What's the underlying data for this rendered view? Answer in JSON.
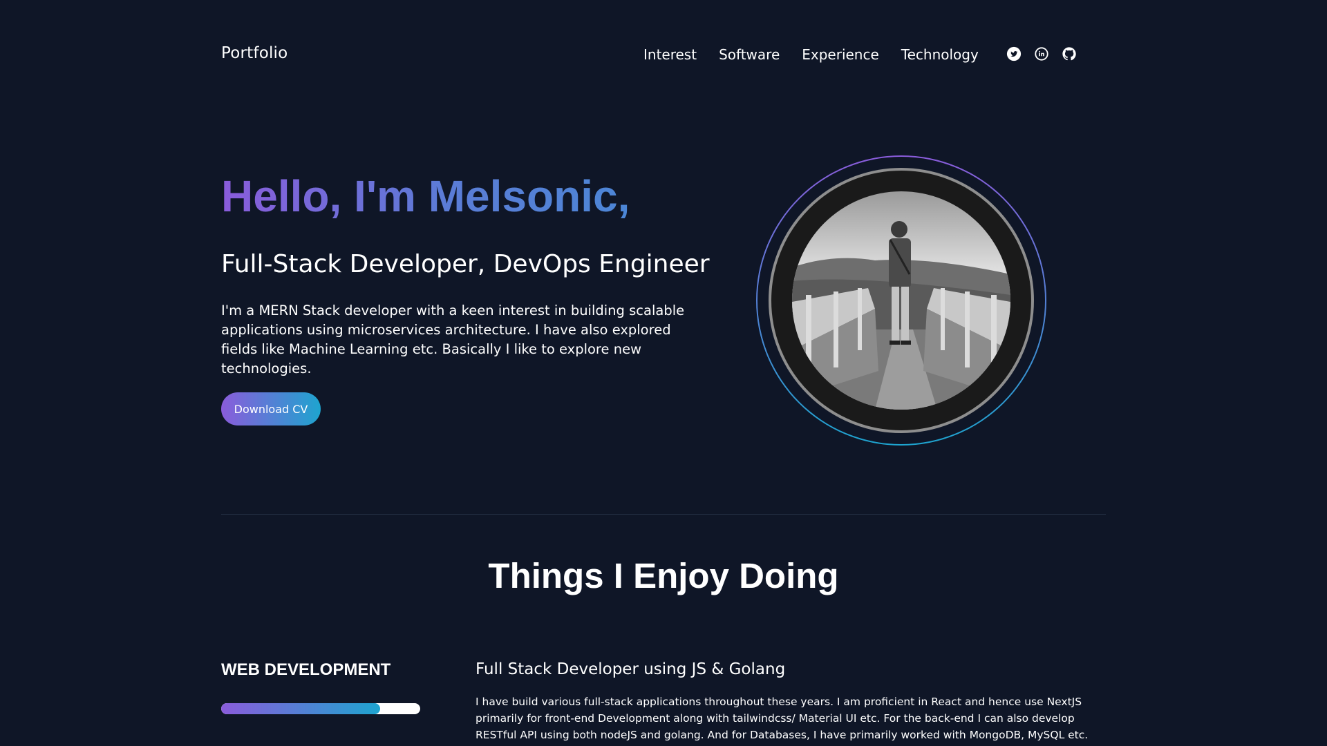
{
  "header": {
    "brand": "Portfolio",
    "nav": [
      "Interest",
      "Software",
      "Experience",
      "Technology"
    ],
    "social_icons": [
      "twitter-icon",
      "linkedin-icon",
      "github-icon"
    ]
  },
  "hero": {
    "greeting": "Hello, I'm Melsonic,",
    "role": "Full-Stack Developer, DevOps Engineer",
    "description": "I'm a MERN Stack developer with a keen interest in building scalable applications using microservices architecture. I have also explored fields like Machine Learning etc. Basically I like to explore new technologies.",
    "cv_button": "Download CV"
  },
  "section": {
    "title": "Things I Enjoy Doing",
    "skills": [
      {
        "name": "WEB DEVELOPMENT",
        "level": 0.8,
        "heading": "Full Stack Developer using JS & Golang",
        "description": "I have build various full-stack applications throughout these years. I am proficient in React and hence use NextJS primarily for front-end Development along with tailwindcss/ Material UI etc. For the back-end I can also develop RESTful API using both nodeJS and golang. And for Databases, I have primarily worked with MongoDB, MySQL etc. Along with"
      }
    ]
  },
  "colors": {
    "background": "#0f1627",
    "accent_purple": "#8a5cdb",
    "accent_cyan": "#1ea4cf"
  }
}
